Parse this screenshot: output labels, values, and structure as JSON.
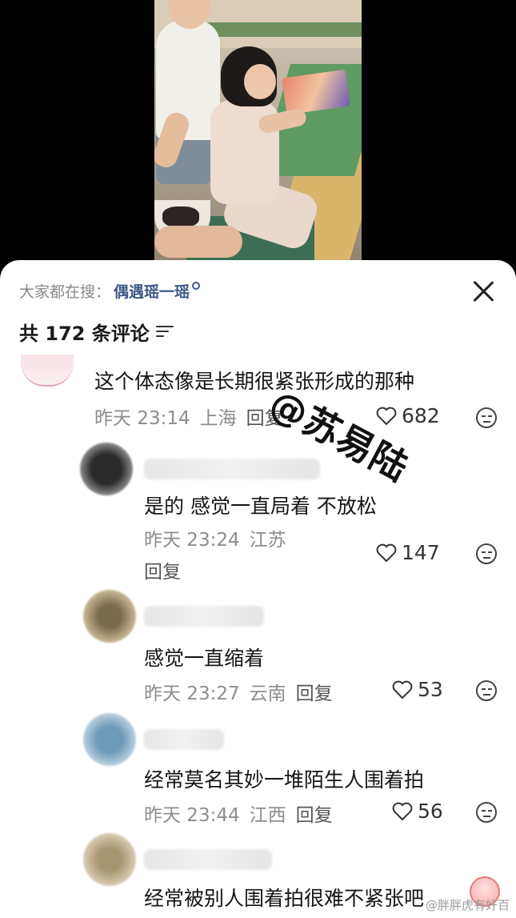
{
  "search_bar": {
    "prefix": "大家都在搜：",
    "term": "偶遇瑶一瑶"
  },
  "comments_header": {
    "count_label": "共 172 条评论"
  },
  "watermark": "@苏易陆",
  "footer_mark": "@胖胖虎有好百",
  "comments": [
    {
      "text": "这个体态像是长期很紧张形成的那种",
      "time": "昨天 23:14",
      "location": "上海",
      "reply": "回复",
      "likes": "682"
    },
    {
      "text": "是的 感觉一直局着 不放松",
      "time": "昨天 23:24",
      "location": "江苏",
      "reply": "回复",
      "likes": "147"
    },
    {
      "text": "感觉一直缩着",
      "time": "昨天 23:27",
      "location": "云南",
      "reply": "回复",
      "likes": "53"
    },
    {
      "text": "经常莫名其妙一堆陌生人围着拍",
      "time": "昨天 23:44",
      "location": "江西",
      "reply": "回复",
      "likes": "56"
    },
    {
      "text": "经常被别人围着拍很难不紧张吧"
    }
  ],
  "colors": {
    "search_term": "#3f5a86",
    "meta_text": "#8d8d8d",
    "sheet_bg": "#ffffff"
  },
  "icons": [
    "search-icon",
    "close-icon",
    "sort-icon",
    "heart-icon",
    "dislike-icon"
  ]
}
